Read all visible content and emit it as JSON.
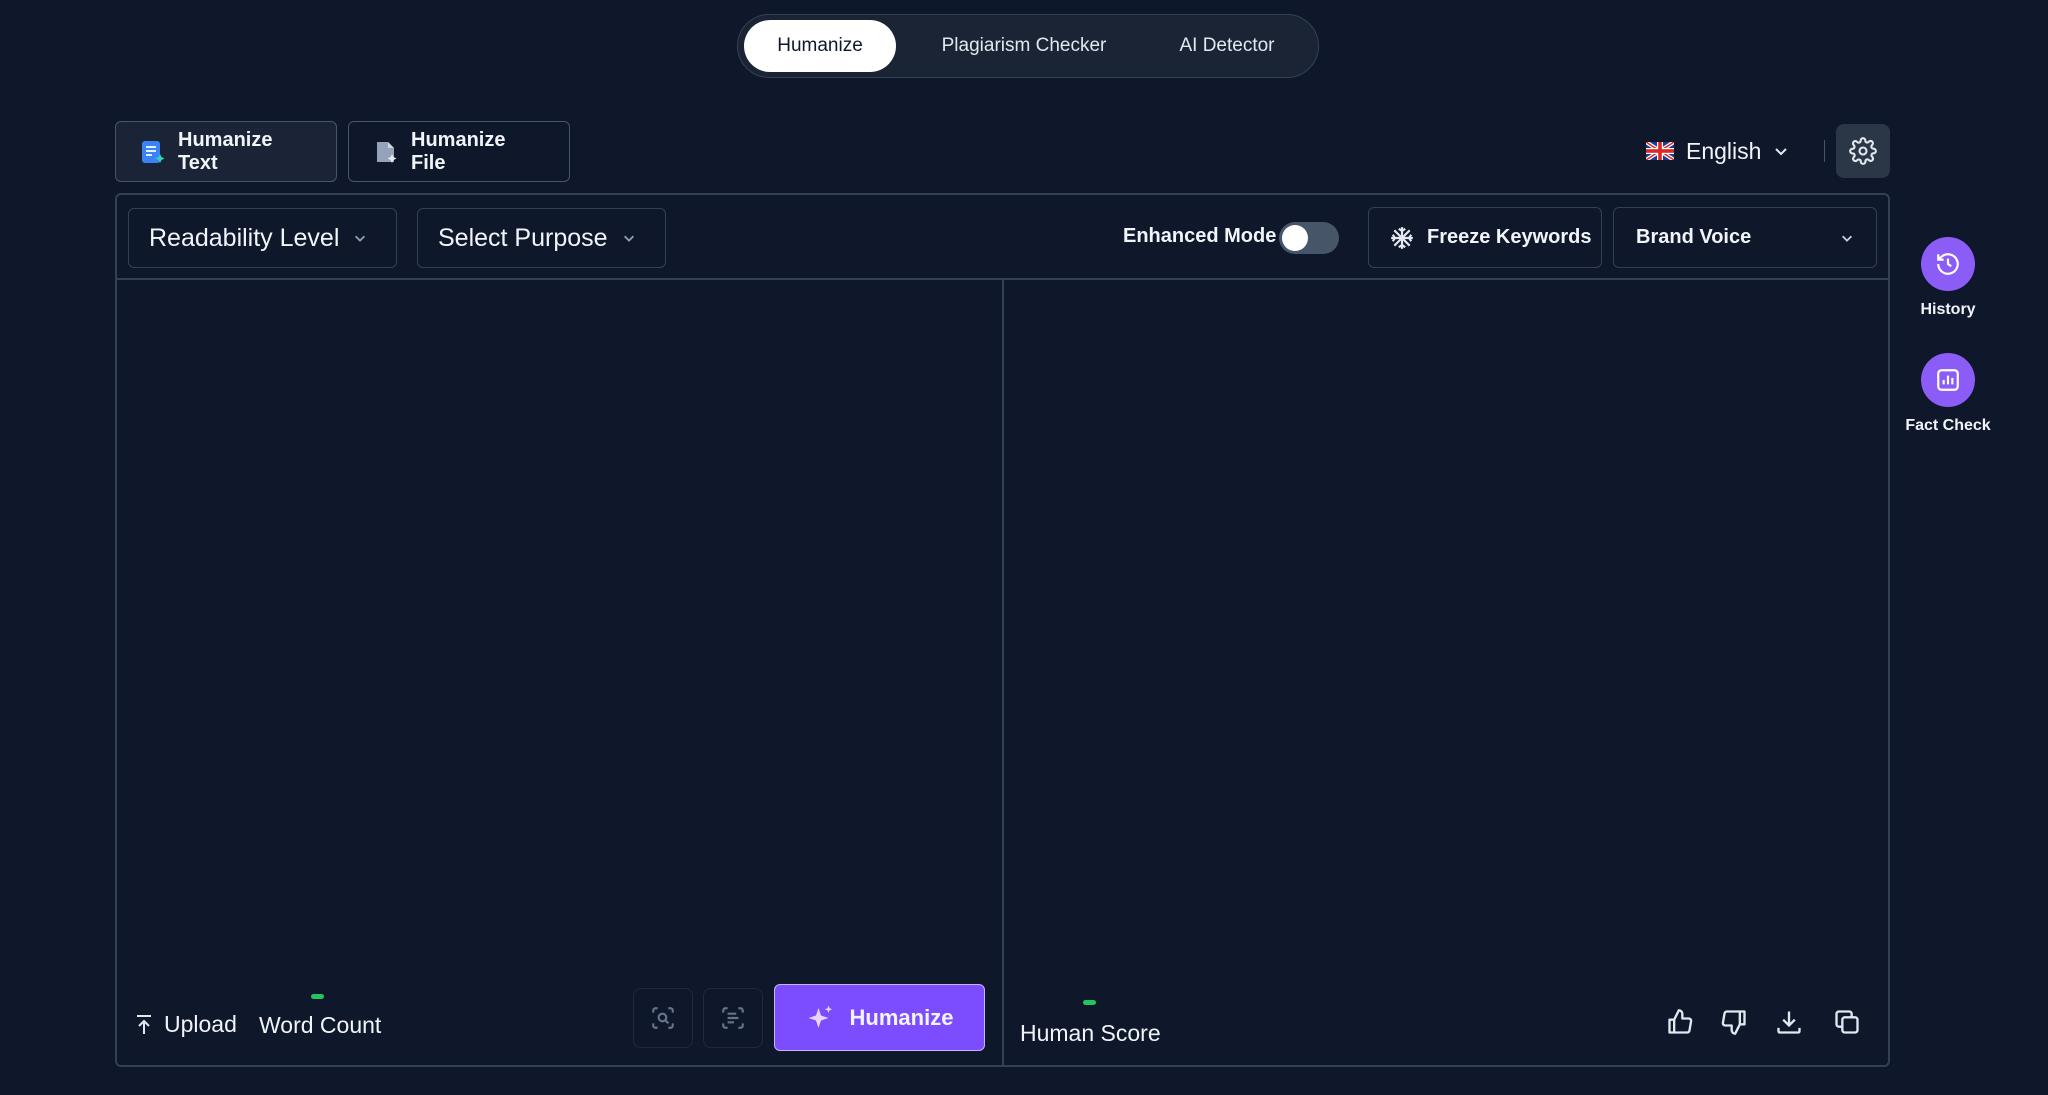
{
  "mode_tabs": {
    "humanize": "Humanize",
    "plagiarism": "Plagiarism Checker",
    "ai_detector": "AI Detector",
    "active": "Humanize"
  },
  "source_tabs": {
    "text": "Humanize Text",
    "file": "Humanize File",
    "active": "Humanize Text"
  },
  "language": {
    "flag": "🇬🇧",
    "label": "English"
  },
  "toolbar": {
    "readability": "Readability Level",
    "purpose": "Select Purpose",
    "enhanced_mode": "Enhanced Mode",
    "enhanced_on": false,
    "freeze": "Freeze Keywords",
    "brand_voice": "Brand Voice"
  },
  "input": {
    "upload": "Upload",
    "word_count": "Word Count",
    "humanize_button": "Humanize"
  },
  "output": {
    "human_score": "Human Score"
  },
  "rail": {
    "history": "History",
    "fact_check": "Fact Check"
  },
  "colors": {
    "background": "#0f172a",
    "accent": "#7c4dff",
    "rail": "#8b5cf6",
    "indicator": "#22c55e"
  }
}
